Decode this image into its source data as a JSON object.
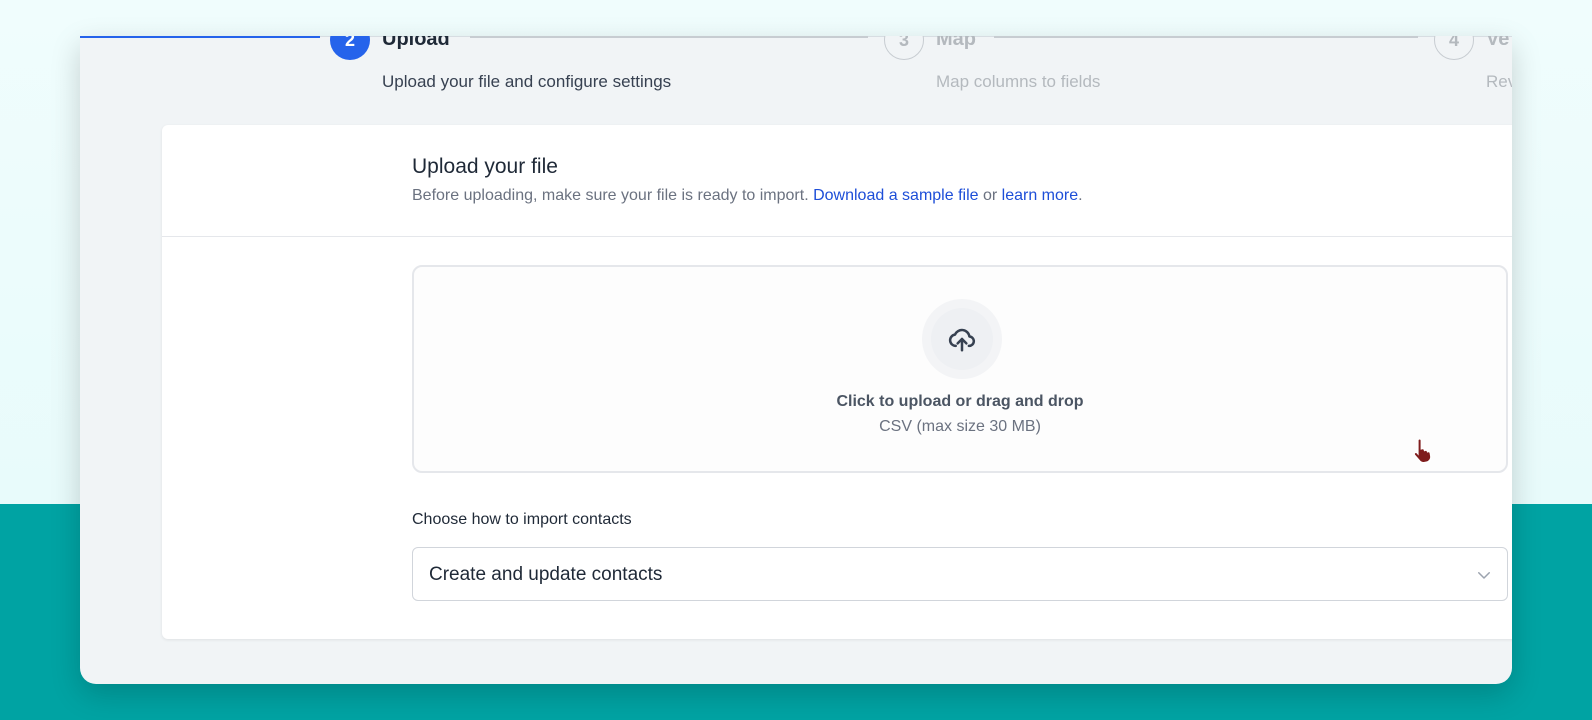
{
  "stepper": {
    "steps": [
      {
        "number": "2",
        "title": "Upload",
        "subtitle": "Upload your file and configure settings",
        "state": "active"
      },
      {
        "number": "3",
        "title": "Map",
        "subtitle": "Map columns to fields",
        "state": "inactive"
      },
      {
        "number": "4",
        "title": "Ve",
        "subtitle": "Rev",
        "state": "inactive"
      }
    ]
  },
  "card": {
    "title": "Upload your file",
    "description_prefix": "Before uploading, make sure your file is ready to import. ",
    "sample_link": "Download a sample file",
    "description_mid": " or ",
    "learn_link": "learn more",
    "description_suffix": "."
  },
  "dropzone": {
    "icon": "cloud-upload-icon",
    "main_text": "Click to upload or drag and drop",
    "sub_text": "CSV (max size 30 MB)"
  },
  "import_mode": {
    "label": "Choose how to import contacts",
    "selected": "Create and update contacts",
    "icon": "chevron-down-icon"
  },
  "colors": {
    "accent": "#2563eb",
    "link": "#1d4ed8",
    "teal_background": "#00a3a3",
    "cursor": "#7f1d1d"
  }
}
